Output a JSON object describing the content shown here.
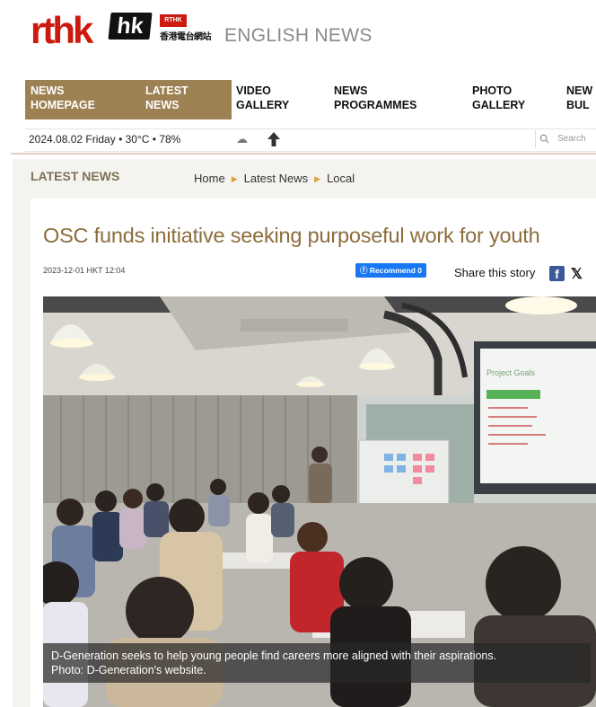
{
  "header": {
    "logo_main": "rthk",
    "logo_hk": "hk",
    "logo_badge": "RTHK",
    "logo_chinese": "香港電台網站",
    "site_section": "ENGLISH NEWS"
  },
  "nav": {
    "items": [
      {
        "line1": "NEWS",
        "line2": "HOMEPAGE"
      },
      {
        "line1": "LATEST",
        "line2": "NEWS"
      },
      {
        "line1": "VIDEO",
        "line2": "GALLERY"
      },
      {
        "line1": "NEWS",
        "line2": "PROGRAMMES"
      },
      {
        "line1": "PHOTO",
        "line2": "GALLERY"
      },
      {
        "line1": "NEW",
        "line2": "BUL"
      }
    ]
  },
  "infobar": {
    "date_weather": "2024.08.02 Friday • 30°C • 78%",
    "search_placeholder": "Search"
  },
  "section": {
    "title": "LATEST NEWS",
    "breadcrumb": [
      "Home",
      "Latest News",
      "Local"
    ]
  },
  "article": {
    "headline": "OSC funds initiative seeking purposeful work for youth",
    "timestamp": "2023-12-01 HKT 12:04",
    "recommend_label": "Recommend 0",
    "share_label": "Share this story",
    "caption_line1": "D-Generation seeks to help young people find careers more aligned with their aspirations.",
    "caption_line2": "Photo: D-Generation's website.",
    "slide_title": "Project Goals"
  },
  "icons": {
    "weather": "cloudy-sun-icon",
    "arrow": "up-arrow-icon",
    "search": "search-icon",
    "facebook": "facebook-icon",
    "x": "x-icon"
  },
  "colors": {
    "brand_red": "#cc1a0e",
    "nav_active": "#9e8153",
    "headline": "#8c6d3c",
    "facebook": "#1877f2"
  }
}
